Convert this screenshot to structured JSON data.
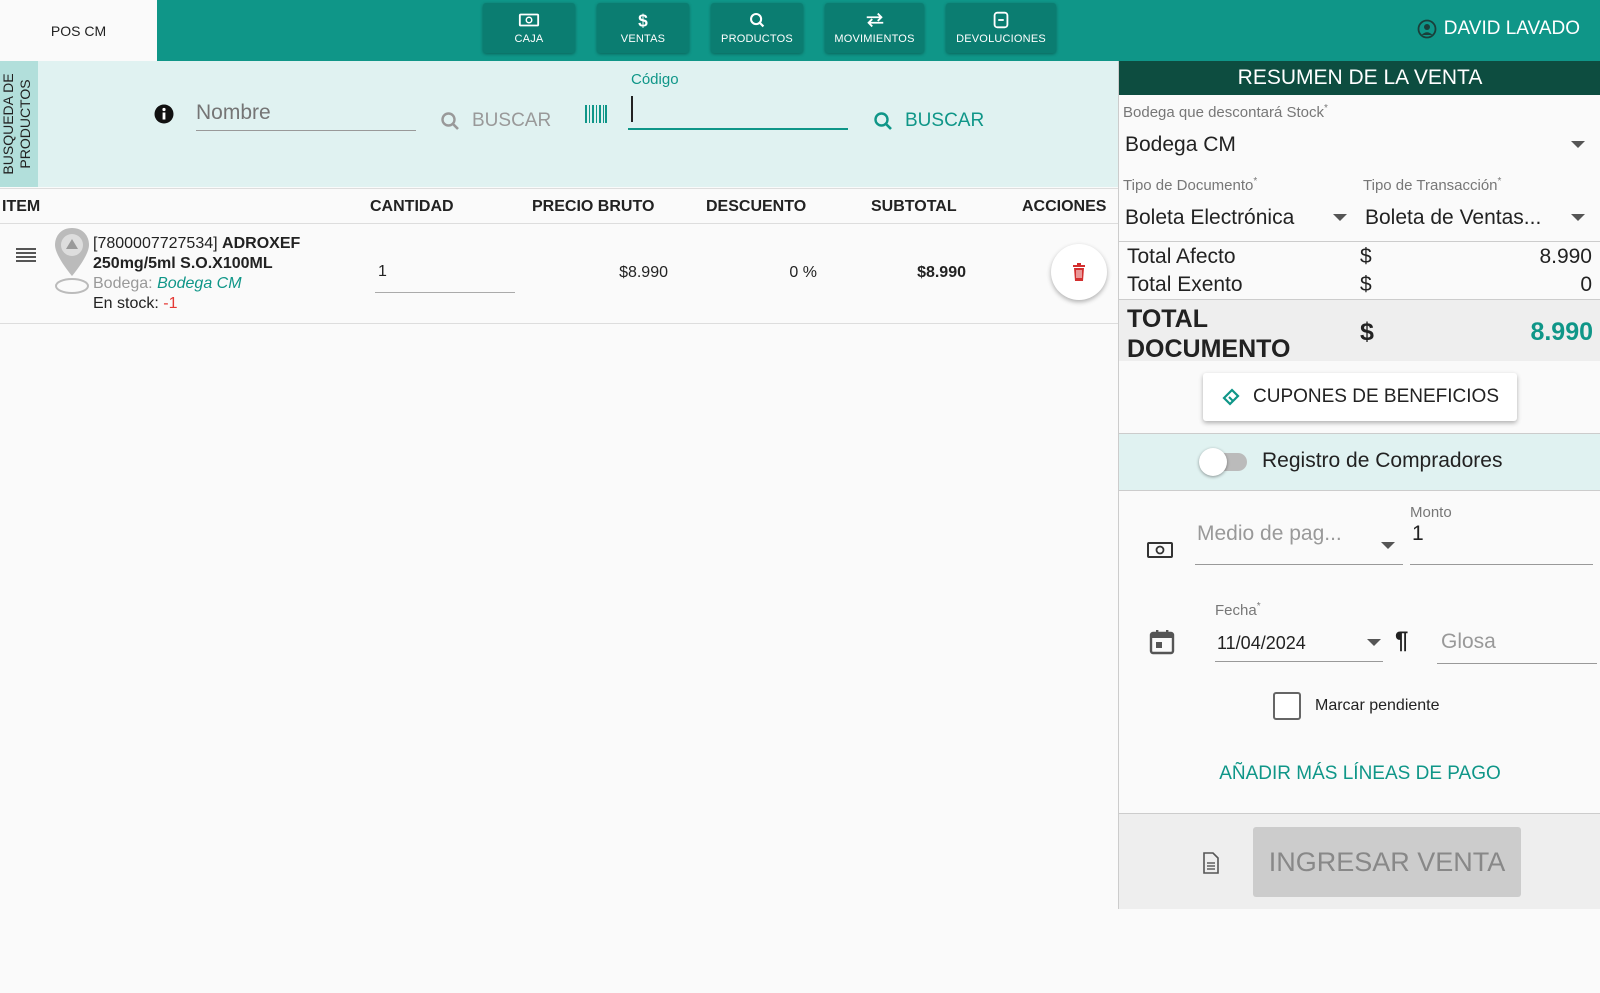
{
  "app": {
    "name": "POS CM"
  },
  "nav": [
    {
      "label": "CAJA",
      "icon": "cash-icon"
    },
    {
      "label": "VENTAS",
      "icon": "dollar-icon"
    },
    {
      "label": "PRODUCTOS",
      "icon": "search-icon"
    },
    {
      "label": "MOVIMIENTOS",
      "icon": "swap-icon"
    },
    {
      "label": "DEVOLUCIONES",
      "icon": "return-icon"
    }
  ],
  "user": {
    "name": "DAVID LAVADO"
  },
  "search": {
    "tab_label": "BUSQUEDA DE PRODUCTOS",
    "name_placeholder": "Nombre",
    "name_button": "BUSCAR",
    "code_label": "Código",
    "code_value": "",
    "code_button": "BUSCAR"
  },
  "table": {
    "headers": [
      "ITEM",
      "CANTIDAD",
      "PRECIO BRUTO",
      "DESCUENTO",
      "SUBTOTAL",
      "ACCIONES"
    ],
    "rows": [
      {
        "code": "[7800007727534]",
        "name": "ADROXEF 250mg/5ml S.O.X100ML",
        "bodega_label": "Bodega:",
        "bodega": "Bodega CM",
        "stock_label": "En stock:",
        "stock": "-1",
        "cantidad": "1",
        "precio_bruto": "$8.990",
        "descuento": "0 %",
        "subtotal": "$8.990"
      }
    ]
  },
  "summary": {
    "title": "RESUMEN DE LA VENTA",
    "bodega_label": "Bodega que descontará Stock",
    "bodega_value": "Bodega CM",
    "tipo_doc_label": "Tipo de Documento",
    "tipo_doc_value": "Boleta Electrónica",
    "tipo_trans_label": "Tipo de Transacción",
    "tipo_trans_value": "Boleta de Ventas...",
    "required_mark": "*",
    "total_afecto_label": "Total Afecto",
    "total_afecto_currency": "$",
    "total_afecto_value": "8.990",
    "total_exento_label": "Total Exento",
    "total_exento_currency": "$",
    "total_exento_value": "0",
    "total_doc_label_1": "TOTAL",
    "total_doc_label_2": "DOCUMENTO",
    "total_doc_currency": "$",
    "total_doc_value": "8.990",
    "cupones_label": "CUPONES DE BENEFICIOS",
    "registro_label": "Registro de Compradores",
    "registro_on": false,
    "medio_pago_placeholder": "Medio de pag...",
    "monto_label": "Monto",
    "monto_value": "1",
    "fecha_label": "Fecha",
    "fecha_value": "11/04/2024",
    "glosa_placeholder": "Glosa",
    "pendiente_label": "Marcar pendiente",
    "pendiente_checked": false,
    "add_lines_label": "AÑADIR MÁS LÍNEAS DE PAGO",
    "ingresar_label": "INGRESAR VENTA"
  },
  "colors": {
    "primary": "#0f9688",
    "panel_header": "#0d4d40",
    "light_band": "#e0f2f1",
    "danger": "#e53935"
  }
}
